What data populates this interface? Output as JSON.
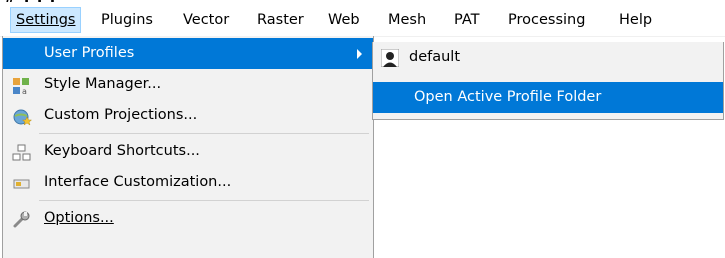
{
  "window": {
    "title_fragment": "# . . ."
  },
  "menubar": {
    "items": [
      {
        "label": "Settings",
        "active": true
      },
      {
        "label": "Plugins"
      },
      {
        "label": "Vector"
      },
      {
        "label": "Raster"
      },
      {
        "label": "Web"
      },
      {
        "label": "Mesh"
      },
      {
        "label": "PAT"
      },
      {
        "label": "Processing"
      },
      {
        "label": "Help"
      }
    ]
  },
  "settings_menu": {
    "items": [
      {
        "label": "User Profiles",
        "icon": "none",
        "highlighted": true,
        "has_submenu": true
      },
      {
        "label": "Style Manager...",
        "icon": "style-manager-icon"
      },
      {
        "label": "Custom Projections...",
        "icon": "globe-star-icon"
      },
      {
        "label": "Keyboard Shortcuts...",
        "icon": "keyboard-shortcuts-icon"
      },
      {
        "label": "Interface Customization...",
        "icon": "interface-customization-icon"
      },
      {
        "label": "Options...",
        "icon": "wrench-icon"
      }
    ]
  },
  "user_profiles_submenu": {
    "items": [
      {
        "label": "default",
        "icon": "user-profile-icon"
      },
      {
        "label": "Open Active Profile Folder",
        "highlighted": true
      }
    ]
  },
  "colors": {
    "highlight": "#0078d7",
    "menubar_active": "#cce8ff",
    "menu_background": "#f2f2f2"
  }
}
